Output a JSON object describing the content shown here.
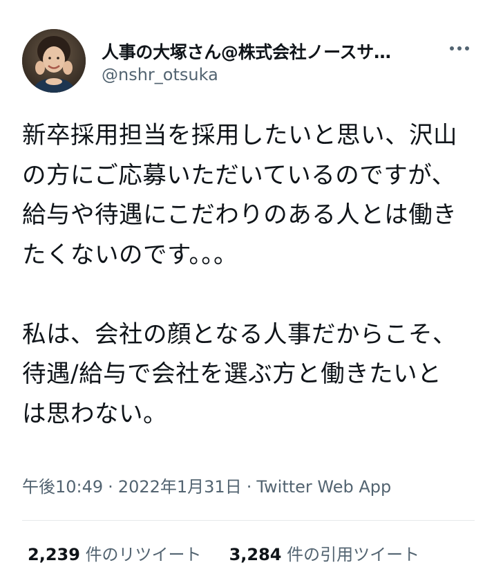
{
  "author": {
    "display_name": "人事の大塚さん@株式会社ノースサ…",
    "handle": "@nshr_otsuka",
    "avatar": "person-photo"
  },
  "more_icon": "more-dots-icon",
  "tweet": {
    "text": "新卒採用担当を採用したいと思い、沢山の方にご応募いただいているのですが、給与や待遇にこだわりのある人とは働きたくないのです。。。\n\n私は、会社の顔となる人事だからこそ、待遇/給与で会社を選ぶ方と働きたいとは思わない。"
  },
  "meta": {
    "time": "午後10:49",
    "separator": "·",
    "date": "2022年1月31日",
    "source": "Twitter Web App"
  },
  "stats": {
    "retweets_count": "2,239",
    "retweets_label": "件のリツイート",
    "quotes_count": "3,284",
    "quotes_label": "件の引用ツイート"
  },
  "colors": {
    "text_primary": "#0f1419",
    "text_secondary": "#536471",
    "divider": "#e6e9eb",
    "background": "#ffffff"
  }
}
